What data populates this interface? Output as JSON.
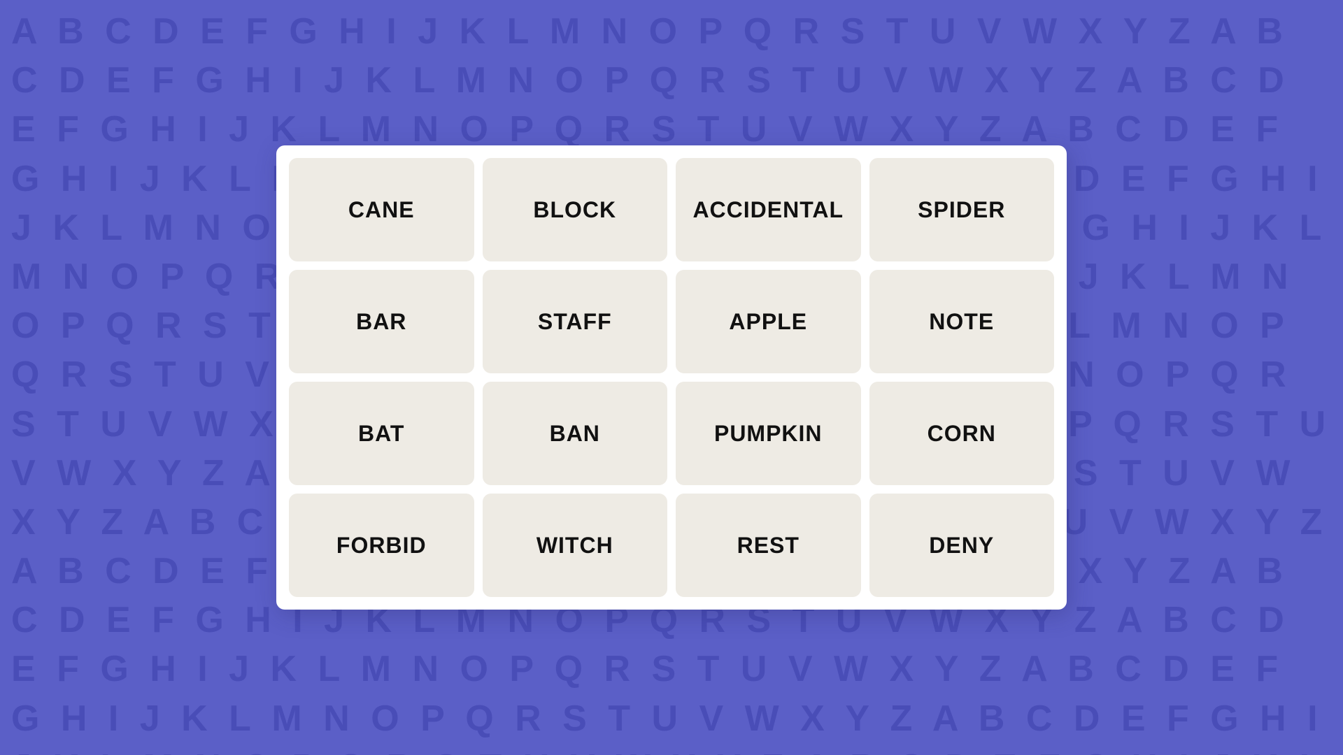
{
  "background": {
    "color": "#5b5fc7",
    "letters": "ABCDEFGHIJKLMNOPQRSTUVWXYZABCDEFGHIJKLMNOPQRSTUVWXYZABCDEFGHIJKLMNOPQRSTUVWXYZABCDEFGHIJKLMNOPQRSTUVWXYZABCDEFGHIJKLMNOPQRSTUVWXYZABCDEFGHIJKLMNOPQRSTUVWXYZABCDEFGHIJKLMNOPQRSTUVWXYZABCDEFGHIJKLMNOPQRSTUVWXYZABCDEFGHIJKLMNOPQRSTUVWXYZABCDEFGHIJKLMNOPQRSTUVWXYZABCDEFGHIJKLMNOPQRSTUVWXYZABCDEFGHIJKLMNOPQRSTUVWXYZ"
  },
  "grid": {
    "cells": [
      {
        "id": "cane",
        "label": "CANE"
      },
      {
        "id": "block",
        "label": "BLOCK"
      },
      {
        "id": "accidental",
        "label": "ACCIDENTAL"
      },
      {
        "id": "spider",
        "label": "SPIDER"
      },
      {
        "id": "bar",
        "label": "BAR"
      },
      {
        "id": "staff",
        "label": "STAFF"
      },
      {
        "id": "apple",
        "label": "APPLE"
      },
      {
        "id": "note",
        "label": "NOTE"
      },
      {
        "id": "bat",
        "label": "BAT"
      },
      {
        "id": "ban",
        "label": "BAN"
      },
      {
        "id": "pumpkin",
        "label": "PUMPKIN"
      },
      {
        "id": "corn",
        "label": "CORN"
      },
      {
        "id": "forbid",
        "label": "FORBID"
      },
      {
        "id": "witch",
        "label": "WITCH"
      },
      {
        "id": "rest",
        "label": "REST"
      },
      {
        "id": "deny",
        "label": "DENY"
      }
    ]
  }
}
